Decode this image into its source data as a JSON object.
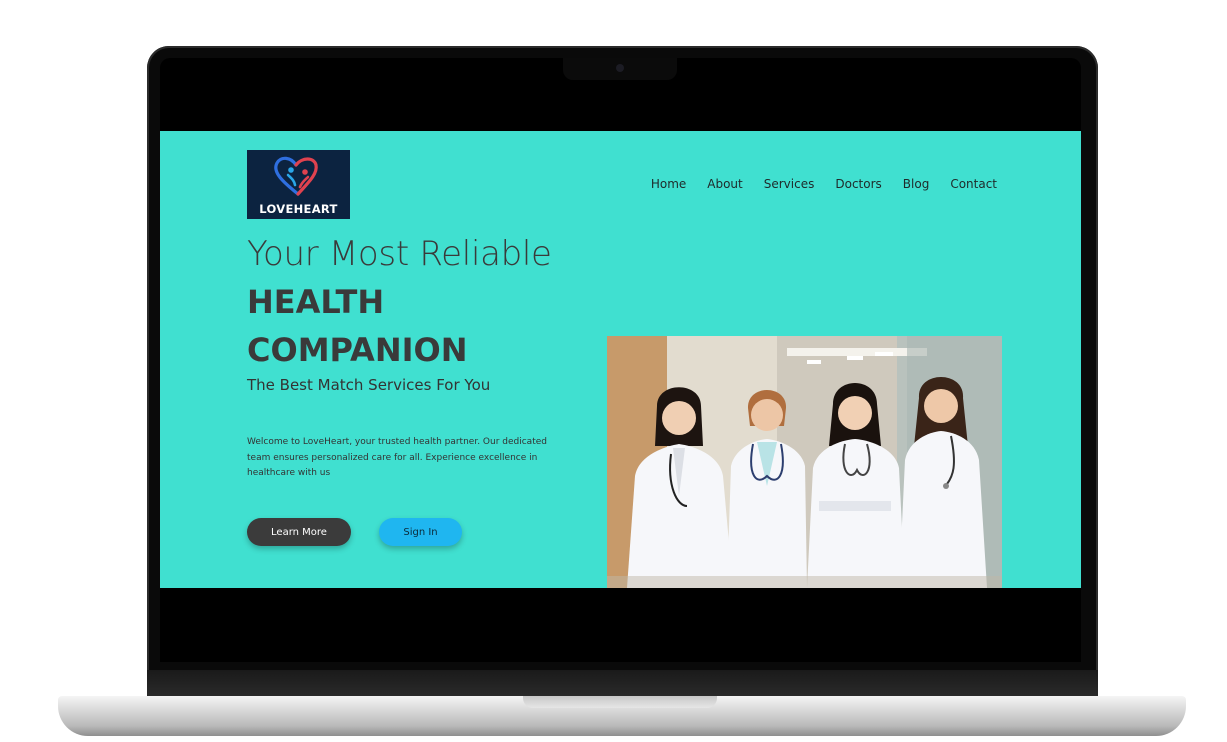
{
  "site": {
    "logo_text": "LOVEHEART",
    "nav": [
      "Home",
      "About",
      "Services",
      "Doctors",
      "Blog",
      "Contact"
    ],
    "hero": {
      "line1": "Your Most Reliable",
      "line2": "HEALTH",
      "line3": "COMPANION",
      "tagline": "The Best Match Services For You",
      "intro": "Welcome to LoveHeart, your trusted health partner. Our dedicated team ensures personalized care for all. Experience excellence in healthcare with us"
    },
    "buttons": {
      "learn_more": "Learn More",
      "sign_in": "Sign In"
    },
    "colors": {
      "background": "#40e0d0",
      "logo_bg": "#0c2340",
      "learn_more_bg": "#3b3b3b",
      "sign_in_bg": "#1fb6f0"
    },
    "photo_subject": "four female doctors in white coats with stethoscopes"
  }
}
